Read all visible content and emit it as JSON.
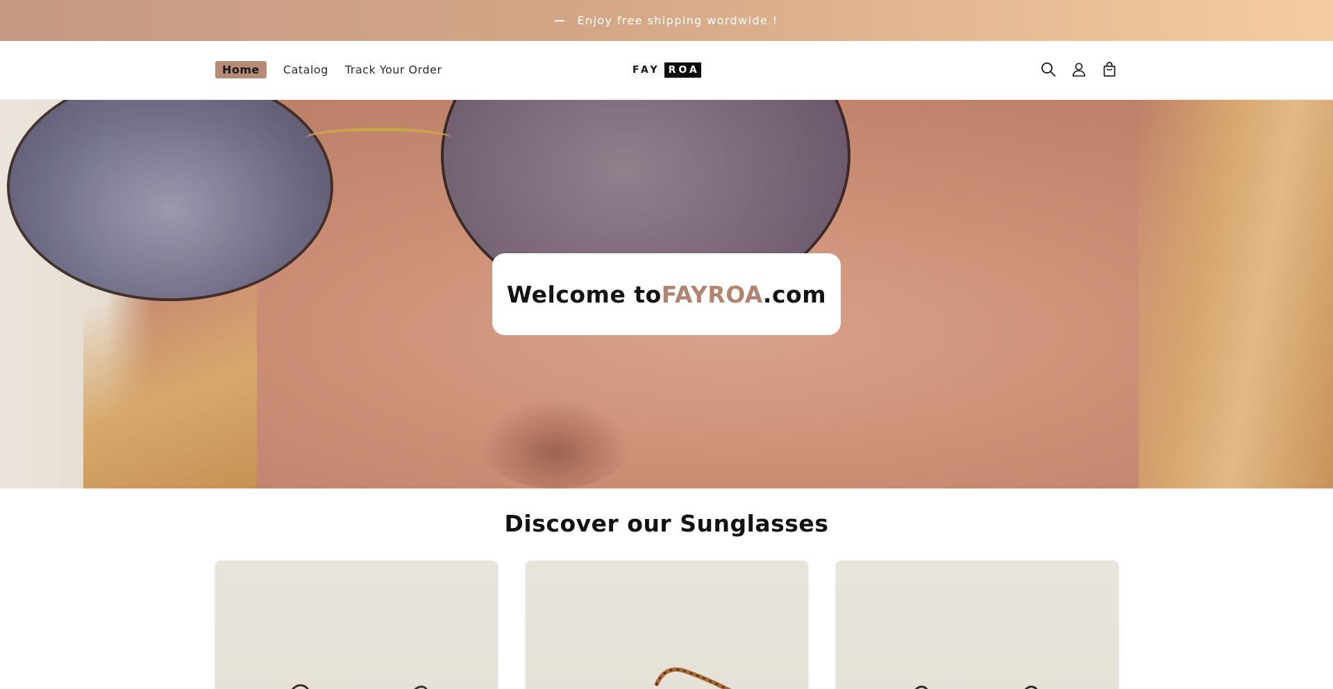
{
  "announcement": {
    "text": "Enjoy free shipping wordwide !"
  },
  "header": {
    "nav": [
      {
        "label": "Home",
        "active": true
      },
      {
        "label": "Catalog",
        "active": false
      },
      {
        "label": "Track Your Order",
        "active": false
      }
    ],
    "logo": {
      "part1": "FAY",
      "part2": "ROA"
    },
    "icons": [
      "search-icon",
      "account-icon",
      "cart-icon"
    ]
  },
  "hero": {
    "welcome_prefix": "Welcome to ",
    "welcome_brand": "FAYROA",
    "welcome_suffix": ".com"
  },
  "section": {
    "title": "Discover our Sunglasses"
  },
  "colors": {
    "accent": "#b2836f",
    "nav_active_bg": "#b88a78",
    "announcement_start": "#c69985",
    "announcement_end": "#f5cc9f"
  }
}
